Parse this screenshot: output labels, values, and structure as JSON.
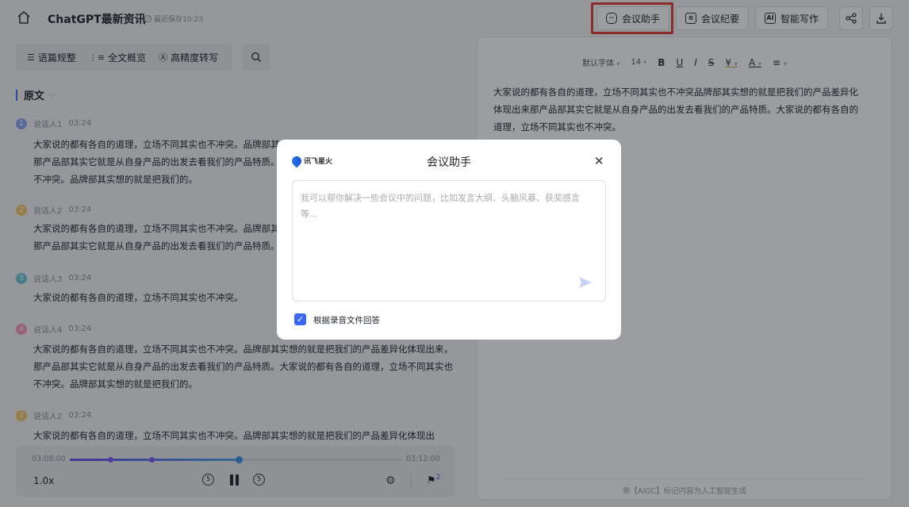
{
  "header": {
    "title": "ChatGPT最新资讯",
    "save_status": "最近保存10:23",
    "buttons": {
      "assistant": "会议助手",
      "minutes": "会议纪要",
      "writing": "智能写作"
    },
    "icons": {
      "assistant": "robot-icon",
      "minutes": "document-icon",
      "writing": "ai-icon",
      "share": "share-icon",
      "download": "download-icon"
    }
  },
  "tools": {
    "items": [
      "语篇规整",
      "全文概览",
      "高精度转写"
    ]
  },
  "transcript": {
    "section_title": "原文",
    "entries": [
      {
        "num": "1",
        "speaker": "说话人1",
        "time": "03:24",
        "color": "#8ea8f5",
        "text": "大家说的都有各自的道理，立场不同其实也不冲突。品牌部其实想的就是把我们的产品差异化体现出来，那产品部其实它就是从自身产品的出发去看我们的产品特质。大家说的都有各自的道理，立场不同其实也不冲突。品牌部其实想的就是把我们的。"
      },
      {
        "num": "2",
        "speaker": "说话人2",
        "time": "03:24",
        "color": "#f5c66a",
        "text": "大家说的都有各自的道理，立场不同其实也不冲突。品牌部其实想的就是把我们的产品差异化体现出来，那产品部其实它就是从自身产品的出发去看我们的产品特质。"
      },
      {
        "num": "3",
        "speaker": "说话人3",
        "time": "03:24",
        "color": "#6fc8d6",
        "text": "大家说的都有各自的道理，立场不同其实也不冲突。"
      },
      {
        "num": "4",
        "speaker": "说话人4",
        "time": "03:24",
        "color": "#f59ab5",
        "text": "大家说的都有各自的道理，立场不同其实也不冲突。品牌部其实想的就是把我们的产品差异化体现出来，那产品部其实它就是从自身产品的出发去看我们的产品特质。大家说的都有各自的道理，立场不同其实也不冲突。品牌部其实想的就是把我们的。"
      },
      {
        "num": "2",
        "speaker": "说话人2",
        "time": "03:24",
        "color": "#f5c66a",
        "text": "大家说的都有各自的道理，立场不同其实也不冲突。品牌部其实想的就是把我们的产品差异化体现出"
      }
    ]
  },
  "player": {
    "current": "03:08:00",
    "total": "03:12:00",
    "speed": "1.0x",
    "skip_back": "5",
    "skip_fwd": "5",
    "flag_count": "2",
    "progress": 0.51
  },
  "editor": {
    "font": "默认字体",
    "size": "14",
    "text": "大家说的都有各自的道理，立场不同其实也不冲突品牌部其实想的就是把我们的产品差异化体现出来那产品部其实它就是从自身产品的出发去看我们的产品特质。大家说的都有各自的道理，立场不同其实也不冲突。",
    "footer": "带【AIGC】标记内容为人工智能生成"
  },
  "modal": {
    "logo": "讯飞星火",
    "title": "会议助手",
    "placeholder": "我可以帮你解决一些会议中的问题，比如发言大纲、头脑风暴、获奖感言等...",
    "checkbox_label": "根据录音文件回答",
    "checkbox_checked": true
  }
}
